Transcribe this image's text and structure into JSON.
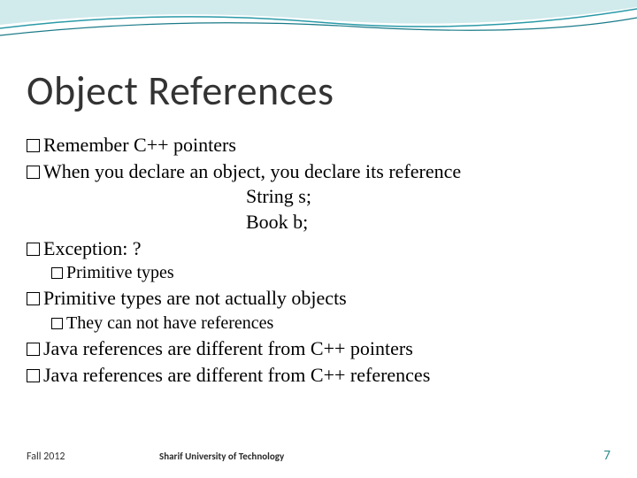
{
  "title": "Object References",
  "bullets": {
    "l1_a": "Remember C++ pointers",
    "l1_b": "When you declare an object, you declare its reference",
    "code1": "String s;",
    "code2": "Book b;",
    "l1_c": "Exception: ?",
    "l2_a": "Primitive types",
    "l1_d": "Primitive types are not actually objects",
    "l2_b": "They can not have references",
    "l1_e": "Java references are different from C++ pointers",
    "l1_f": "Java references are different from C++ references"
  },
  "footer": {
    "left": "Fall 2012",
    "center": "Sharif University of Technology",
    "pagenum": "7"
  }
}
